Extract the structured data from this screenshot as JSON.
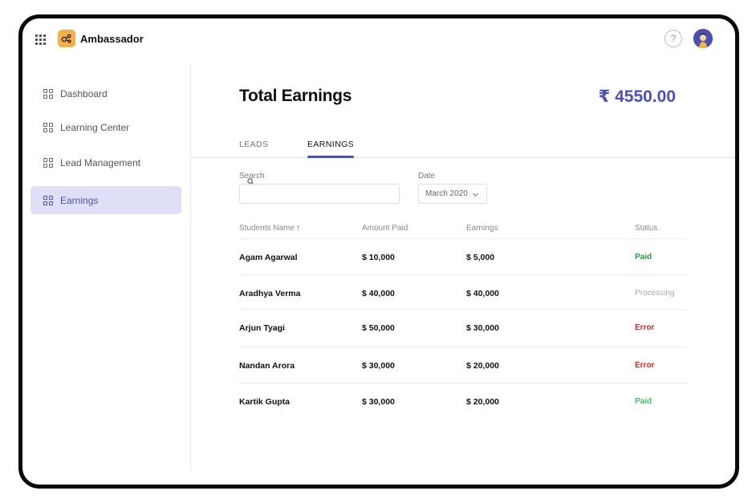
{
  "app": {
    "title": "Ambassador"
  },
  "header": {
    "help_glyph": "?"
  },
  "sidebar": {
    "items": [
      {
        "label": "Dashboard"
      },
      {
        "label": "Learning Center"
      },
      {
        "label": "Lead Management"
      },
      {
        "label": "Earnings",
        "active": true
      }
    ]
  },
  "main": {
    "title": "Total Earnings",
    "total": "₹ 4550.00",
    "tabs": [
      {
        "label": "LEADS"
      },
      {
        "label": "EARNINGS",
        "active": true
      }
    ],
    "search": {
      "label": "Search",
      "value": "",
      "placeholder": ""
    },
    "date": {
      "label": "Date",
      "value": "March 2020"
    },
    "table": {
      "columns": [
        "Students Name",
        "Amount Paid",
        "Earnings",
        "Status"
      ],
      "sort_indicator": "↑",
      "rows": [
        {
          "name": "Agam Agarwal",
          "amount": "$ 10,000",
          "earnings": "$ 5,000",
          "status": "Paid"
        },
        {
          "name": "Aradhya Verma",
          "amount": "$ 40,000",
          "earnings": "$ 40,000",
          "status": "Processing"
        },
        {
          "name": "Arjun Tyagi",
          "amount": "$ 50,000",
          "earnings": "$ 30,000",
          "status": "Error"
        },
        {
          "name": "Nandan Arora",
          "amount": "$ 30,000",
          "earnings": "$ 20,000",
          "status": "Error"
        },
        {
          "name": "Kartik Gupta",
          "amount": "$ 30,000",
          "earnings": "$ 20,000",
          "status": "Paid"
        }
      ]
    }
  },
  "colors": {
    "accent": "#4b4fc4",
    "paid": "#1f9d3f",
    "paid_light": "#3fbf5f",
    "processing": "#a8a8a8",
    "error": "#d62828",
    "logo": "#f6b04a"
  }
}
